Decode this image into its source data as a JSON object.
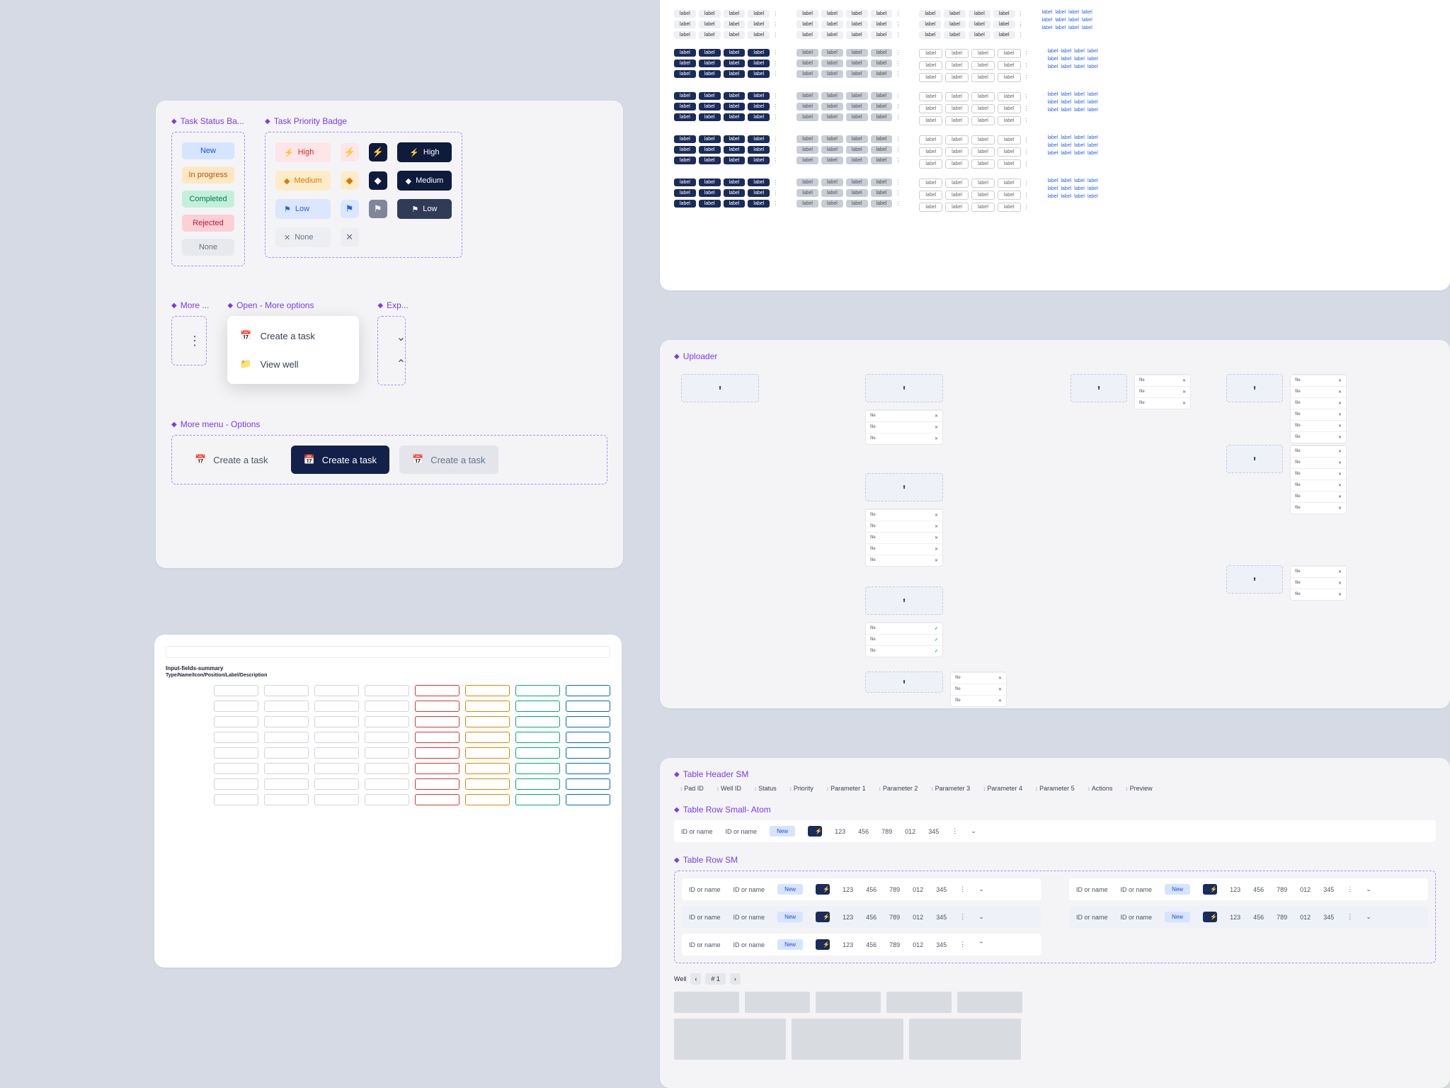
{
  "panel1": {
    "status_title": "Task Status Ba...",
    "priority_title": "Task Priority Badge",
    "statuses": {
      "new": "New",
      "progress": "In progress",
      "completed": "Completed",
      "rejected": "Rejected",
      "none": "None"
    },
    "priorities": {
      "high": "High",
      "medium": "Medium",
      "low": "Low",
      "none": "None"
    },
    "more_title": "More ...",
    "open_title": "Open - More options",
    "expand_title": "Exp...",
    "menu_items": {
      "create": "Create a task",
      "view": "View well"
    },
    "more_menu_title": "More menu - Options",
    "option_label": "Create a task"
  },
  "panel2": {
    "desc": "Input-fields-summary",
    "sub": "Type/Name/Icon/Position/Label/Description"
  },
  "panel4": {
    "title": "Uploader"
  },
  "panel5": {
    "hdr_title": "Table Header SM",
    "row_atom_title": "Table Row  Small- Atom",
    "row_title": "Table Row SM",
    "columns": [
      "Pad ID",
      "Well ID",
      "Status",
      "Priority",
      "Parameter 1",
      "Parameter 2",
      "Parameter 3",
      "Parameter 4",
      "Parameter 5",
      "Actions",
      "Preview"
    ],
    "cell_id": "ID or name",
    "status_chip": "New",
    "vals": [
      "123",
      "456",
      "789",
      "012",
      "345"
    ],
    "pager_label": "Well",
    "pager_value": "# 1"
  }
}
